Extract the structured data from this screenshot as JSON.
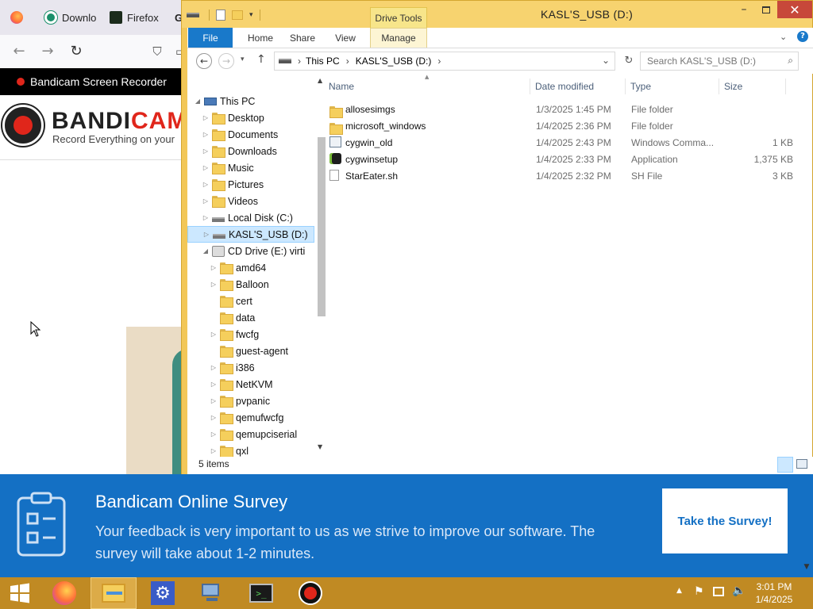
{
  "browser": {
    "tabs": [
      {
        "label": ""
      },
      {
        "label": "Downlo"
      },
      {
        "label": "Firefox"
      },
      {
        "label": "G"
      }
    ],
    "bookmark_bar": {
      "label": "Bandicam Screen Recorder",
      "extra": "B"
    },
    "header": {
      "logo_text_dark": "BANDI",
      "logo_text_red": "CAM",
      "tagline": "Record Everything on your"
    }
  },
  "explorer": {
    "title": "KASL'S_USB (D:)",
    "drive_tools_label": "Drive Tools",
    "ribbon_tabs": [
      {
        "label": "File"
      },
      {
        "label": "Home"
      },
      {
        "label": "Share"
      },
      {
        "label": "View"
      },
      {
        "label": "Manage"
      }
    ],
    "address": {
      "segments": [
        "This PC",
        "KASL'S_USB (D:)"
      ],
      "separator": "›"
    },
    "search": {
      "placeholder": "Search KASL'S_USB (D:)"
    },
    "nav_tree": [
      {
        "label": "This PC",
        "level": 0,
        "expanded": true
      },
      {
        "label": "Desktop",
        "level": 1
      },
      {
        "label": "Documents",
        "level": 1
      },
      {
        "label": "Downloads",
        "level": 1
      },
      {
        "label": "Music",
        "level": 1
      },
      {
        "label": "Pictures",
        "level": 1
      },
      {
        "label": "Videos",
        "level": 1
      },
      {
        "label": "Local Disk (C:)",
        "level": 1
      },
      {
        "label": "KASL'S_USB (D:)",
        "level": 1,
        "selected": true
      },
      {
        "label": "CD Drive (E:) virti",
        "level": 1,
        "expanded": true
      },
      {
        "label": "amd64",
        "level": 2
      },
      {
        "label": "Balloon",
        "level": 2
      },
      {
        "label": "cert",
        "level": 2
      },
      {
        "label": "data",
        "level": 2
      },
      {
        "label": "fwcfg",
        "level": 2
      },
      {
        "label": "guest-agent",
        "level": 2
      },
      {
        "label": "i386",
        "level": 2
      },
      {
        "label": "NetKVM",
        "level": 2
      },
      {
        "label": "pvpanic",
        "level": 2
      },
      {
        "label": "qemufwcfg",
        "level": 2
      },
      {
        "label": "qemupciserial",
        "level": 2
      },
      {
        "label": "qxl",
        "level": 2
      }
    ],
    "columns": {
      "name": "Name",
      "date": "Date modified",
      "type": "Type",
      "size": "Size"
    },
    "files": [
      {
        "name": "allosesimgs",
        "date": "1/3/2025 1:45 PM",
        "type": "File folder",
        "size": "",
        "icon": "folder-icon"
      },
      {
        "name": "microsoft_windows",
        "date": "1/4/2025 2:36 PM",
        "type": "File folder",
        "size": "",
        "icon": "folder-icon"
      },
      {
        "name": "cygwin_old",
        "date": "1/4/2025 2:43 PM",
        "type": "Windows Comma...",
        "size": "1 KB",
        "icon": "batch-file-icon"
      },
      {
        "name": "cygwinsetup",
        "date": "1/4/2025 2:33 PM",
        "type": "Application",
        "size": "1,375 KB",
        "icon": "cygwin-app-icon"
      },
      {
        "name": "StarEater.sh",
        "date": "1/4/2025 2:32 PM",
        "type": "SH File",
        "size": "3 KB",
        "icon": "file-icon"
      }
    ],
    "status": {
      "item_count": "5 items"
    }
  },
  "survey": {
    "title": "Bandicam Online Survey",
    "body": "Your feedback is very important to us as we strive to improve our software. The survey will take about 1-2 minutes.",
    "button_label": "Take the Survey!"
  },
  "taskbar": {
    "apps": [
      "firefox-icon",
      "file-explorer-icon",
      "settings-icon",
      "network-computer-icon",
      "console-icon",
      "bandicam-icon"
    ],
    "clock": {
      "time": "3:01 PM",
      "date": "1/4/2025"
    }
  },
  "colors": {
    "explorer_frame": "#f2c758",
    "taskbar": "#c08a23",
    "survey_banner": "#1470c4",
    "bandicam_red": "#e0261b",
    "close_button": "#c7483a"
  }
}
